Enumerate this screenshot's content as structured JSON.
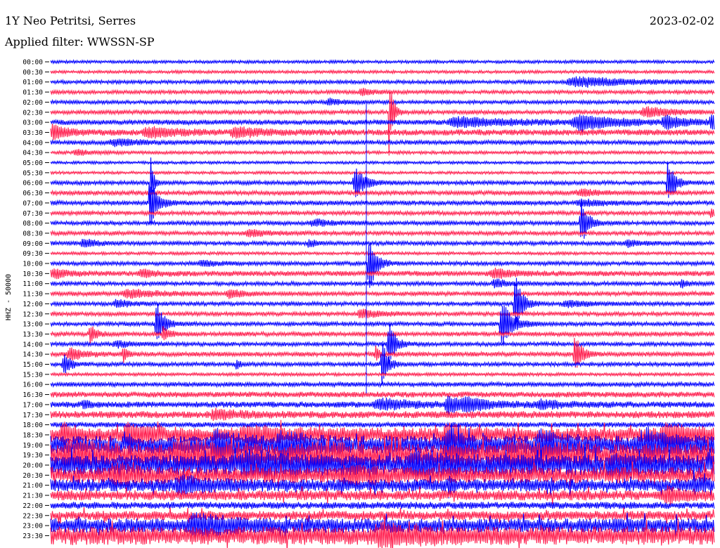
{
  "header": {
    "station": "1Y Neo Petritsi, Serres",
    "date": "2023-02-02",
    "filter": "Applied filter: WWSSN-SP"
  },
  "chart_data": {
    "type": "line",
    "kind": "helicorder",
    "channel_label": "HHZ - 50000",
    "colors": [
      "#0000ff",
      "#ff1f4f"
    ],
    "rows": [
      {
        "label": "00:00",
        "color": "blue",
        "noise": 1.5,
        "events": []
      },
      {
        "label": "00:30",
        "color": "red",
        "noise": 1.5,
        "events": []
      },
      {
        "label": "01:00",
        "color": "blue",
        "noise": 1.8,
        "events": [
          [
            0.8,
            6,
            0.08
          ]
        ]
      },
      {
        "label": "01:30",
        "color": "red",
        "noise": 1.8,
        "events": [
          [
            0.47,
            4,
            0.02
          ]
        ]
      },
      {
        "label": "02:00",
        "color": "blue",
        "noise": 1.8,
        "events": [
          [
            0.42,
            4,
            0.02
          ]
        ]
      },
      {
        "label": "02:30",
        "color": "red",
        "noise": 2.0,
        "events": [
          [
            0.9,
            6,
            0.04
          ],
          [
            0.51,
            60,
            0.005
          ]
        ]
      },
      {
        "label": "03:00",
        "color": "blue",
        "noise": 2.5,
        "events": [
          [
            0.62,
            6,
            0.08
          ],
          [
            0.8,
            10,
            0.05
          ],
          [
            0.93,
            7,
            0.03
          ],
          [
            0.995,
            9,
            0.01
          ]
        ]
      },
      {
        "label": "03:30",
        "color": "red",
        "noise": 3.0,
        "events": [
          [
            0.005,
            9,
            0.02
          ],
          [
            0.15,
            6,
            0.04
          ],
          [
            0.28,
            7,
            0.03
          ]
        ]
      },
      {
        "label": "04:00",
        "color": "blue",
        "noise": 2.2,
        "events": [
          [
            0.1,
            4,
            0.04
          ]
        ]
      },
      {
        "label": "04:30",
        "color": "red",
        "noise": 1.6,
        "events": [
          [
            0.04,
            4,
            0.02
          ]
        ]
      },
      {
        "label": "05:00",
        "color": "blue",
        "noise": 1.4,
        "events": []
      },
      {
        "label": "05:30",
        "color": "red",
        "noise": 1.4,
        "events": []
      },
      {
        "label": "06:00",
        "color": "blue",
        "noise": 2.0,
        "events": [
          [
            0.15,
            45,
            0.004
          ],
          [
            0.46,
            18,
            0.015
          ],
          [
            0.93,
            30,
            0.01
          ]
        ]
      },
      {
        "label": "06:30",
        "color": "red",
        "noise": 2.2,
        "events": [
          [
            0.8,
            4,
            0.03
          ]
        ]
      },
      {
        "label": "07:00",
        "color": "blue",
        "noise": 2.2,
        "events": [
          [
            0.15,
            35,
            0.01
          ],
          [
            0.8,
            4,
            0.03
          ]
        ]
      },
      {
        "label": "07:30",
        "color": "red",
        "noise": 2.0,
        "events": [
          [
            0.995,
            6,
            0.005
          ]
        ]
      },
      {
        "label": "08:00",
        "color": "blue",
        "noise": 2.0,
        "events": [
          [
            0.8,
            30,
            0.01
          ],
          [
            0.4,
            4,
            0.03
          ]
        ]
      },
      {
        "label": "08:30",
        "color": "red",
        "noise": 2.0,
        "events": [
          [
            0.3,
            4,
            0.03
          ]
        ]
      },
      {
        "label": "09:00",
        "color": "blue",
        "noise": 2.0,
        "events": [
          [
            0.05,
            5,
            0.02
          ],
          [
            0.39,
            5,
            0.01
          ],
          [
            0.87,
            4,
            0.02
          ]
        ]
      },
      {
        "label": "09:30",
        "color": "red",
        "noise": 1.5,
        "events": []
      },
      {
        "label": "10:00",
        "color": "blue",
        "noise": 2.0,
        "events": [
          [
            0.48,
            40,
            0.01
          ],
          [
            0.23,
            4,
            0.02
          ]
        ]
      },
      {
        "label": "10:30",
        "color": "red",
        "noise": 2.6,
        "events": [
          [
            0.005,
            6,
            0.02
          ],
          [
            0.14,
            5,
            0.02
          ],
          [
            0.67,
            5,
            0.03
          ]
        ]
      },
      {
        "label": "11:00",
        "color": "blue",
        "noise": 2.0,
        "events": [
          [
            0.67,
            5,
            0.02
          ],
          [
            0.95,
            5,
            0.01
          ]
        ]
      },
      {
        "label": "11:30",
        "color": "red",
        "noise": 2.2,
        "events": [
          [
            0.12,
            5,
            0.04
          ],
          [
            0.27,
            5,
            0.02
          ]
        ]
      },
      {
        "label": "12:00",
        "color": "blue",
        "noise": 2.0,
        "events": [
          [
            0.1,
            5,
            0.02
          ],
          [
            0.7,
            38,
            0.01
          ],
          [
            0.78,
            4,
            0.03
          ]
        ]
      },
      {
        "label": "12:30",
        "color": "red",
        "noise": 2.0,
        "events": [
          [
            0.47,
            5,
            0.03
          ]
        ]
      },
      {
        "label": "13:00",
        "color": "blue",
        "noise": 2.0,
        "events": [
          [
            0.16,
            30,
            0.01
          ],
          [
            0.68,
            30,
            0.015
          ]
        ]
      },
      {
        "label": "13:30",
        "color": "red",
        "noise": 2.2,
        "events": [
          [
            0.06,
            12,
            0.008
          ],
          [
            0.17,
            8,
            0.01
          ]
        ]
      },
      {
        "label": "14:00",
        "color": "blue",
        "noise": 2.0,
        "events": [
          [
            0.51,
            28,
            0.01
          ],
          [
            0.1,
            4,
            0.02
          ]
        ]
      },
      {
        "label": "14:30",
        "color": "red",
        "noise": 2.2,
        "events": [
          [
            0.03,
            8,
            0.02
          ],
          [
            0.11,
            12,
            0.005
          ],
          [
            0.49,
            10,
            0.005
          ],
          [
            0.79,
            25,
            0.01
          ]
        ]
      },
      {
        "label": "15:00",
        "color": "blue",
        "noise": 2.0,
        "events": [
          [
            0.02,
            14,
            0.01
          ],
          [
            0.28,
            6,
            0.005
          ],
          [
            0.5,
            30,
            0.008
          ]
        ]
      },
      {
        "label": "15:30",
        "color": "red",
        "noise": 1.6,
        "events": []
      },
      {
        "label": "16:00",
        "color": "blue",
        "noise": 2.2,
        "events": []
      },
      {
        "label": "16:30",
        "color": "red",
        "noise": 2.8,
        "events": []
      },
      {
        "label": "17:00",
        "color": "blue",
        "noise": 3.0,
        "events": [
          [
            0.5,
            6,
            0.05
          ],
          [
            0.6,
            10,
            0.02
          ],
          [
            0.63,
            6,
            0.04
          ],
          [
            0.74,
            5,
            0.03
          ],
          [
            0.05,
            5,
            0.01
          ]
        ]
      },
      {
        "label": "17:30",
        "color": "red",
        "noise": 3.5,
        "events": [
          [
            0.25,
            6,
            0.03
          ]
        ]
      },
      {
        "label": "18:00",
        "color": "blue",
        "noise": 2.5,
        "events": []
      },
      {
        "label": "18:30",
        "color": "red",
        "noise": 7.0,
        "events": [
          [
            0.02,
            10,
            0.02
          ],
          [
            0.12,
            12,
            0.03
          ],
          [
            0.3,
            8,
            0.05
          ],
          [
            0.6,
            10,
            0.03
          ],
          [
            0.93,
            10,
            0.04
          ]
        ]
      },
      {
        "label": "19:00",
        "color": "blue",
        "noise": 9.0,
        "events": [
          [
            0.25,
            14,
            0.03
          ],
          [
            0.35,
            12,
            0.03
          ],
          [
            0.6,
            18,
            0.02
          ],
          [
            0.74,
            12,
            0.04
          ],
          [
            0.9,
            14,
            0.03
          ]
        ]
      },
      {
        "label": "19:30",
        "color": "red",
        "noise": 11.0,
        "events": [
          [
            0.03,
            10,
            0.04
          ],
          [
            0.2,
            12,
            0.05
          ],
          [
            0.4,
            8,
            0.05
          ],
          [
            0.7,
            10,
            0.05
          ]
        ]
      },
      {
        "label": "20:00",
        "color": "blue",
        "noise": 10.0,
        "events": [
          [
            0.3,
            10,
            0.05
          ],
          [
            0.55,
            10,
            0.05
          ],
          [
            0.85,
            8,
            0.04
          ]
        ]
      },
      {
        "label": "20:30",
        "color": "red",
        "noise": 8.0,
        "events": [
          [
            0.1,
            8,
            0.04
          ],
          [
            0.45,
            8,
            0.04
          ]
        ]
      },
      {
        "label": "21:00",
        "color": "blue",
        "noise": 6.0,
        "events": [
          [
            0.2,
            8,
            0.04
          ],
          [
            0.6,
            14,
            0.005
          ],
          [
            0.97,
            6,
            0.02
          ]
        ]
      },
      {
        "label": "21:30",
        "color": "red",
        "noise": 5.0,
        "events": [
          [
            0.93,
            8,
            0.03
          ]
        ]
      },
      {
        "label": "22:00",
        "color": "blue",
        "noise": 3.5,
        "events": []
      },
      {
        "label": "22:30",
        "color": "red",
        "noise": 4.5,
        "events": []
      },
      {
        "label": "23:00",
        "color": "blue",
        "noise": 7.0,
        "events": [
          [
            0.22,
            10,
            0.05
          ]
        ]
      },
      {
        "label": "23:30",
        "color": "red",
        "noise": 9.0,
        "events": [
          [
            0.5,
            8,
            0.05
          ]
        ]
      }
    ]
  }
}
